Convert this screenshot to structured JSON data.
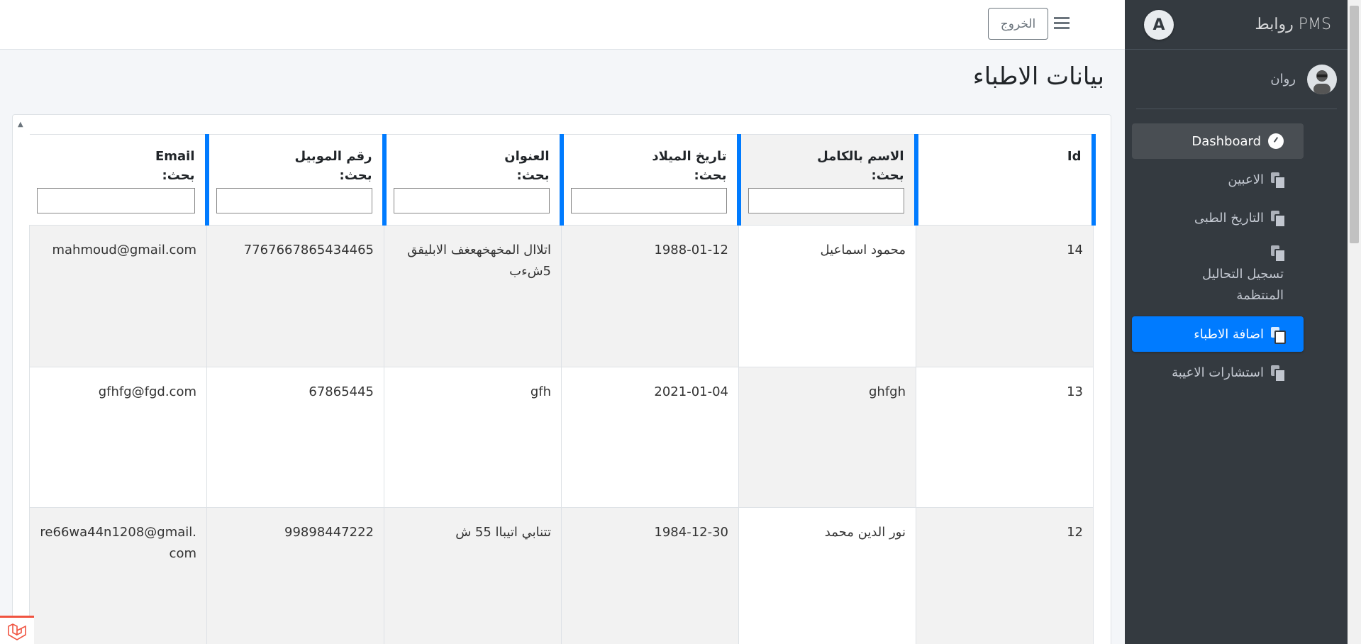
{
  "brand": {
    "title": "روابط PMS",
    "logo_letter": "A"
  },
  "user": {
    "name": "روان"
  },
  "sidebar": {
    "items": [
      {
        "label": "Dashboard",
        "icon": "gauge-icon",
        "state": "dashboard"
      },
      {
        "label": "الاعبين",
        "icon": "copy-icon"
      },
      {
        "label": "التاريخ الطبى",
        "icon": "copy-icon"
      },
      {
        "label": "تسجيل التحاليل المنتظمة",
        "icon": "copy-icon"
      },
      {
        "label": "اضافة الاطباء",
        "icon": "copy-icon",
        "state": "active"
      },
      {
        "label": "استشارات الاعيبة",
        "icon": "copy-icon"
      }
    ]
  },
  "header": {
    "logout_label": "الخروج",
    "menu_icon": "hamburger-icon"
  },
  "page": {
    "title": "بيانات الاطباء"
  },
  "table": {
    "search_label": "بحث:",
    "columns": [
      "Id",
      "الاسم بالكامل",
      "تاريخ الميلاد",
      "العنوان",
      "رقم الموبيل",
      "Email"
    ],
    "rows": [
      [
        "14",
        "محمود اسماعيل",
        "1988-01-12",
        "اتلاال المخهخهعغف الابليقق 5شءب",
        "7767667865434465",
        "mahmoud@gmail.com"
      ],
      [
        "13",
        "ghfgh",
        "2021-01-04",
        "gfh",
        "67865445",
        "gfhfg@fgd.com"
      ],
      [
        "12",
        "نور الدين محمد",
        "1984-12-30",
        "تتنابي اتيباا 55 ش",
        "99898447222",
        "re66wa44n1208@gmail.com"
      ]
    ]
  },
  "colors": {
    "sidebar_bg": "#343a40",
    "accent": "#007bff"
  }
}
